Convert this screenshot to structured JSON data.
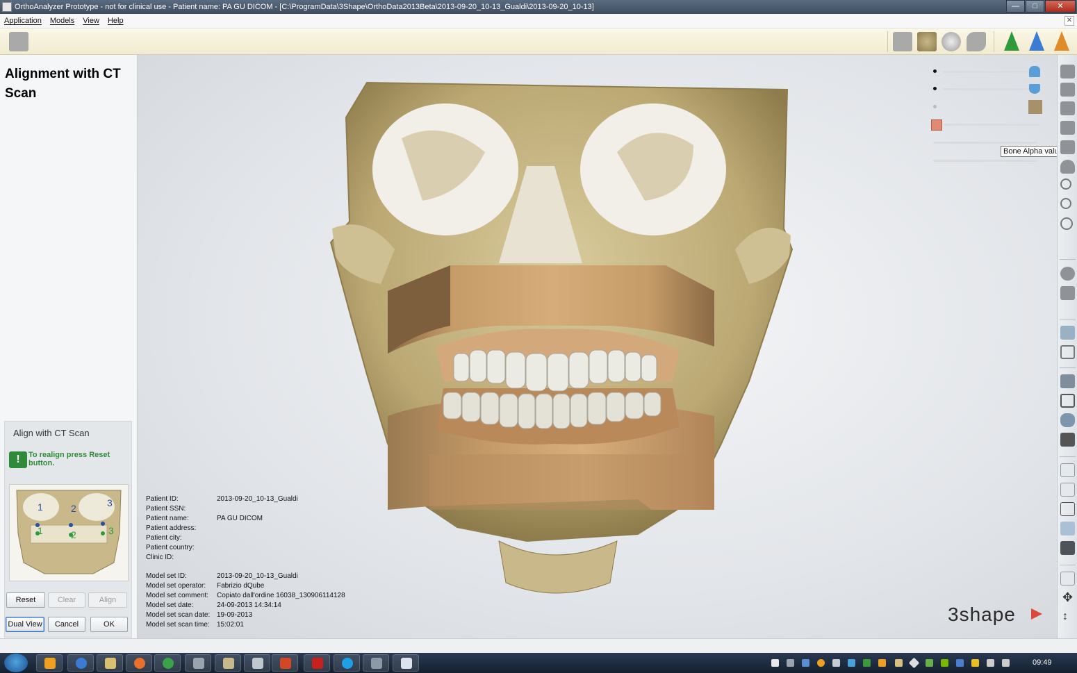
{
  "window": {
    "title": "OrthoAnalyzer Prototype - not for clinical use - Patient name: PA GU DICOM - [C:\\ProgramData\\3Shape\\OrthoData2013Beta\\2013-09-20_10-13_Gualdi\\2013-09-20_10-13]",
    "min_icon": "minimize-icon",
    "max_icon": "maximize-icon",
    "close_icon": "close-icon"
  },
  "menu": {
    "items": [
      "Application",
      "Models",
      "View",
      "Help"
    ]
  },
  "left_panel": {
    "title": "Alignment with CT Scan",
    "align_box": {
      "title": "Align with CT Scan",
      "message": "To realign press Reset button.",
      "thumb_labels": [
        "1",
        "2",
        "3",
        "1",
        "2",
        "3"
      ]
    },
    "buttons": {
      "reset": "Reset",
      "clear": "Clear",
      "align": "Align",
      "dual_view": "Dual View",
      "cancel": "Cancel",
      "ok": "OK"
    }
  },
  "patient_info": [
    {
      "label": "Patient ID:",
      "value": "2013-09-20_10-13_Gualdi"
    },
    {
      "label": "Patient SSN:",
      "value": ""
    },
    {
      "label": "Patient name:",
      "value": "PA GU DICOM"
    },
    {
      "label": "Patient address:",
      "value": ""
    },
    {
      "label": "Patient city:",
      "value": ""
    },
    {
      "label": "Patient country:",
      "value": ""
    },
    {
      "label": "Clinic ID:",
      "value": ""
    }
  ],
  "model_info": [
    {
      "label": "Model set ID:",
      "value": "2013-09-20_10-13_Gualdi"
    },
    {
      "label": "Model set operator:",
      "value": "Fabrizio dQube"
    },
    {
      "label": "Model set comment:",
      "value": "Copiato dall'ordine 16038_130906114128"
    },
    {
      "label": "Model set date:",
      "value": "24-09-2013 14:34:14"
    },
    {
      "label": "Model set scan date:",
      "value": "19-09-2013"
    },
    {
      "label": "Model set scan time:",
      "value": "15:02:01"
    }
  ],
  "tooltip": "Bone Alpha value",
  "logo": "3shape",
  "taskbar": {
    "clock": "09:49"
  },
  "colors": {
    "bone": "#c9b98a",
    "model_base": "#c49a68",
    "accent_green": "#2f8a3a",
    "logo_red": "#d94a3b"
  }
}
